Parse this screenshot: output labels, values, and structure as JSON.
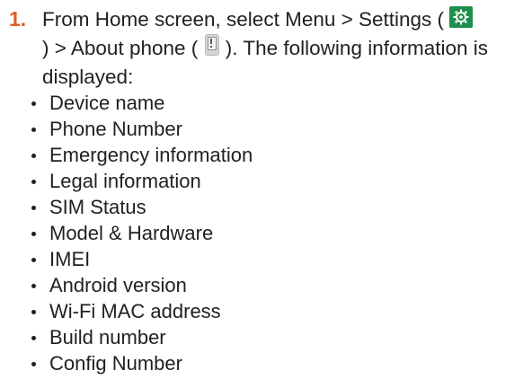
{
  "step": {
    "number": "1.",
    "line1_text": "From Home screen, select Menu > Settings  (",
    "line2_prefix": ") > About phone (",
    "line2_suffix": "). The following information is",
    "line3_text": "displayed:",
    "settings_icon": "gear-icon",
    "about_icon": "phone-info-icon",
    "accent_color": "#e35b25",
    "settings_icon_color": "#1e8f4c"
  },
  "info_items": [
    "Device name",
    "Phone Number",
    "Emergency information",
    "Legal information",
    "SIM Status",
    "Model & Hardware",
    "IMEI",
    "Android version",
    "Wi-Fi MAC address",
    "Build number",
    "Config Number"
  ]
}
